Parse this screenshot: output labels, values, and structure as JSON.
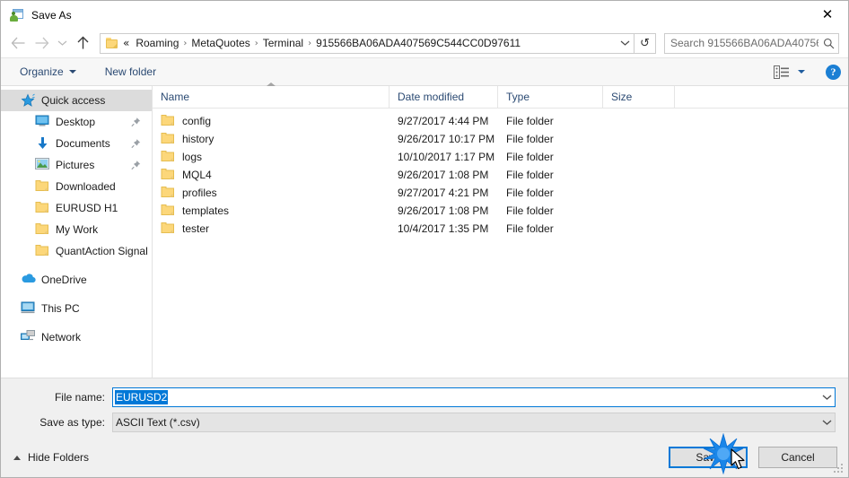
{
  "window": {
    "title": "Save As",
    "icon": "save-as-icon",
    "close_label": "✕"
  },
  "nav": {
    "back_icon": "arrow-left-icon",
    "forward_icon": "arrow-right-icon",
    "recent_icon": "chevron-down-icon",
    "up_icon": "arrow-up-icon",
    "breadcrumb_prefix": "«",
    "breadcrumb": [
      "Roaming",
      "MetaQuotes",
      "Terminal",
      "915566BA06ADA407569C544CC0D97611"
    ],
    "breadcrumb_separator": "›",
    "breadcrumb_dropdown_icon": "chevron-down-icon",
    "refresh_icon": "↺",
    "refresh_name": "refresh-icon"
  },
  "search": {
    "placeholder": "Search 915566BA06ADA40756...",
    "icon": "search-icon"
  },
  "toolbar": {
    "organize_label": "Organize",
    "new_folder_label": "New folder",
    "view_icon": "view-list-icon",
    "view_caret_icon": "chevron-down-icon",
    "help_label": "?",
    "help_icon": "help-icon"
  },
  "sidebar": {
    "items": [
      {
        "label": "Quick access",
        "icon": "star-icon",
        "level": "root",
        "selected": true,
        "pinned": false
      },
      {
        "label": "Desktop",
        "icon": "desktop-icon",
        "level": "child",
        "selected": false,
        "pinned": true
      },
      {
        "label": "Documents",
        "icon": "documents-download-icon",
        "level": "child",
        "selected": false,
        "pinned": true
      },
      {
        "label": "Pictures",
        "icon": "pictures-icon",
        "level": "child",
        "selected": false,
        "pinned": true
      },
      {
        "label": "Downloaded",
        "icon": "folder-icon",
        "level": "child",
        "selected": false,
        "pinned": false
      },
      {
        "label": "EURUSD H1",
        "icon": "folder-icon",
        "level": "child",
        "selected": false,
        "pinned": false
      },
      {
        "label": "My Work",
        "icon": "folder-icon",
        "level": "child",
        "selected": false,
        "pinned": false
      },
      {
        "label": "QuantAction Signal",
        "icon": "folder-icon",
        "level": "child",
        "selected": false,
        "pinned": false
      },
      {
        "label": "OneDrive",
        "icon": "onedrive-cloud-icon",
        "level": "group",
        "selected": false,
        "pinned": false
      },
      {
        "label": "This PC",
        "icon": "computer-icon",
        "level": "group",
        "selected": false,
        "pinned": false
      },
      {
        "label": "Network",
        "icon": "network-icon",
        "level": "group",
        "selected": false,
        "pinned": false
      }
    ]
  },
  "filelist": {
    "columns": [
      "Name",
      "Date modified",
      "Type",
      "Size"
    ],
    "sort_column": "Name",
    "sort_direction": "ascending",
    "rows": [
      {
        "name": "config",
        "date": "9/27/2017 4:44 PM",
        "type": "File folder",
        "size": ""
      },
      {
        "name": "history",
        "date": "9/26/2017 10:17 PM",
        "type": "File folder",
        "size": ""
      },
      {
        "name": "logs",
        "date": "10/10/2017 1:17 PM",
        "type": "File folder",
        "size": ""
      },
      {
        "name": "MQL4",
        "date": "9/26/2017 1:08 PM",
        "type": "File folder",
        "size": ""
      },
      {
        "name": "profiles",
        "date": "9/27/2017 4:21 PM",
        "type": "File folder",
        "size": ""
      },
      {
        "name": "templates",
        "date": "9/26/2017 1:08 PM",
        "type": "File folder",
        "size": ""
      },
      {
        "name": "tester",
        "date": "10/4/2017 1:35 PM",
        "type": "File folder",
        "size": ""
      }
    ]
  },
  "form": {
    "filename_label": "File name:",
    "filename_value": "EURUSD2",
    "filename_selected": true,
    "savetype_label": "Save as type:",
    "savetype_value": "ASCII Text (*.csv)",
    "dropdown_icon": "chevron-down-icon"
  },
  "footer": {
    "hide_folders_label": "Hide Folders",
    "hide_folders_icon": "chevron-up-icon",
    "save_label": "Save",
    "cancel_label": "Cancel",
    "resize_grip": "resize-grip-icon"
  },
  "colors": {
    "accent": "#0078d7",
    "breadcrumb_text": "#1b1b1b",
    "header_text": "#2b4a73",
    "folder_yellow": "#fcd77a",
    "selection": "#dcdcdc",
    "panel": "#f0f0f0"
  },
  "pointer": {
    "click_effect": "blue-starburst",
    "cursor": "arrow-cursor"
  }
}
